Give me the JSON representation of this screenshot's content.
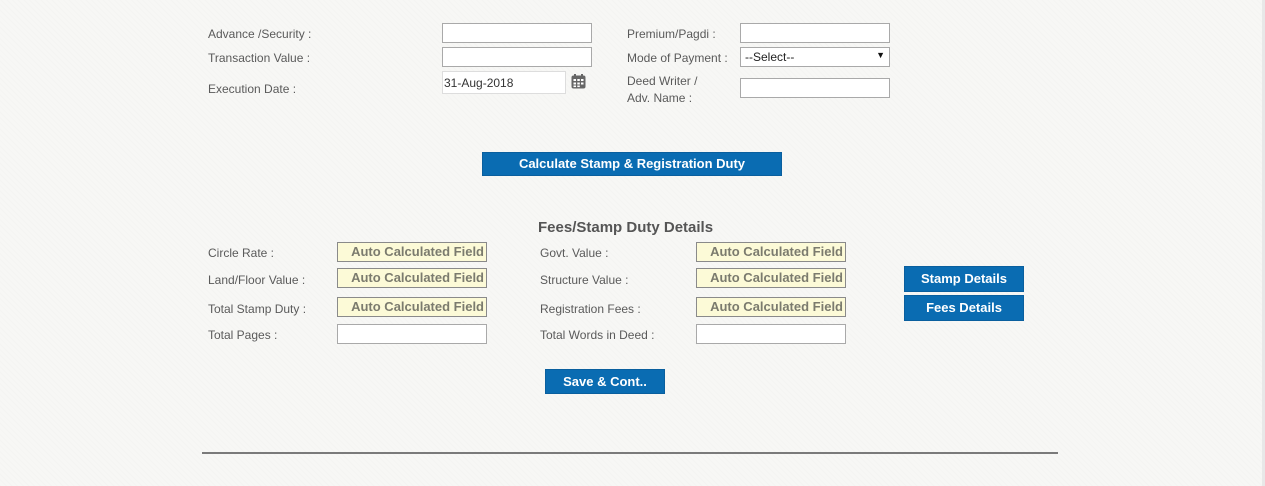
{
  "form": {
    "advance_security": {
      "label": "Advance /Security :",
      "value": ""
    },
    "premium_pagdi": {
      "label": "Premium/Pagdi :",
      "value": ""
    },
    "transaction_value": {
      "label": "Transaction Value :",
      "value": ""
    },
    "mode_of_payment": {
      "label": "Mode of Payment :",
      "selected": "--Select--"
    },
    "execution_date": {
      "label": "Execution Date :",
      "value": "31-Aug-2018"
    },
    "deed_writer": {
      "label_line1": "Deed Writer /",
      "label_line2": "Adv. Name :",
      "value": ""
    }
  },
  "calculate_button": {
    "label": "Calculate Stamp & Registration Duty"
  },
  "fees_section": {
    "title": "Fees/Stamp Duty Details",
    "auto_text": "Auto Calculated Field",
    "circle_rate": {
      "label": "Circle Rate :"
    },
    "govt_value": {
      "label": "Govt. Value :"
    },
    "land_floor_value": {
      "label": "Land/Floor Value :"
    },
    "structure_value": {
      "label": "Structure Value :"
    },
    "total_stamp_duty": {
      "label": "Total Stamp Duty :"
    },
    "registration_fees": {
      "label": "Registration Fees :"
    },
    "total_pages": {
      "label": "Total Pages :",
      "value": ""
    },
    "total_words": {
      "label": "Total Words in Deed :",
      "value": ""
    },
    "stamp_details_button": {
      "label": "Stamp Details"
    },
    "fees_details_button": {
      "label": "Fees Details"
    }
  },
  "save_button": {
    "label": "Save & Cont.."
  },
  "icons": {
    "calendar": "calendar-icon",
    "dropdown": "chevron-down-icon"
  },
  "colors": {
    "button": "#0a6cb2",
    "auto_field_bg": "#fcfad7",
    "auto_field_text": "#7b7b6e"
  }
}
